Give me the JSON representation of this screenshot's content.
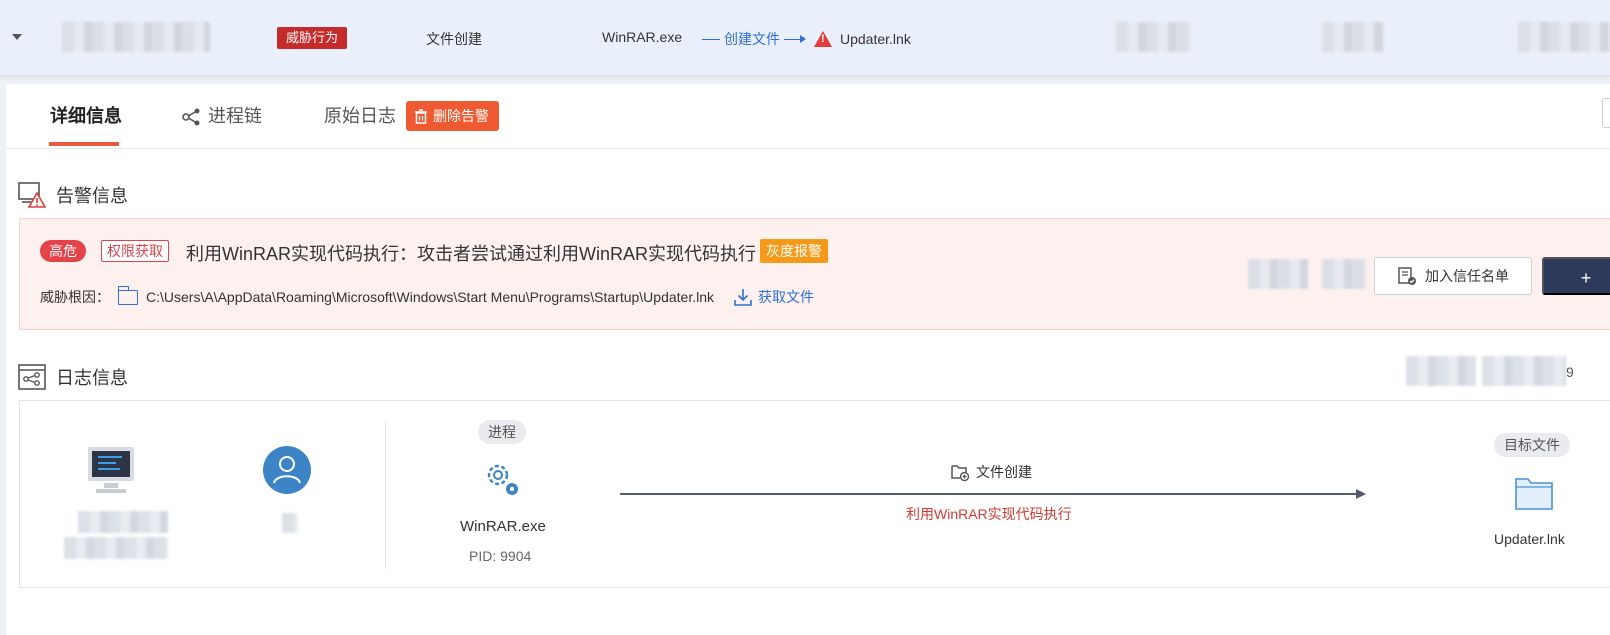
{
  "summary": {
    "threat_tag": "威胁行为",
    "event_type": "文件创建",
    "process": "WinRAR.exe",
    "chain_action": "创建文件",
    "target_file": "Updater.lnk"
  },
  "tabs": {
    "details": "详细信息",
    "process_chain": "进程链",
    "raw_log": "原始日志",
    "delete_alert": "删除告警"
  },
  "alert_section": {
    "title": "告警信息",
    "severity": "高危",
    "category": "权限获取",
    "alert_title": "利用WinRAR实现代码执行：攻击者尝试通过利用WinRAR实现代码执行",
    "gray_tag": "灰度报警",
    "root_cause_label": "威胁根因：",
    "root_cause_path": "C:\\Users\\A\\AppData\\Roaming\\Microsoft\\Windows\\Start Menu\\Programs\\Startup\\Updater.lnk",
    "get_file": "获取文件",
    "trust_button": "加入信任名单",
    "dark_button": "+"
  },
  "log_section": {
    "title": "日志信息",
    "process_pill": "进程",
    "process_name": "WinRAR.exe",
    "pid": "PID: 9904",
    "action": "文件创建",
    "action_desc": "利用WinRAR实现代码执行",
    "target_pill": "目标文件",
    "target_name": "Updater.lnk",
    "right_fragment": "9"
  },
  "colors": {
    "accent_red": "#e5424a",
    "threat_red": "#c62b2b",
    "link_blue": "#2f6fd6",
    "orange": "#f05a32",
    "gray_tag": "#f49a18",
    "navy": "#2e3a5c"
  }
}
